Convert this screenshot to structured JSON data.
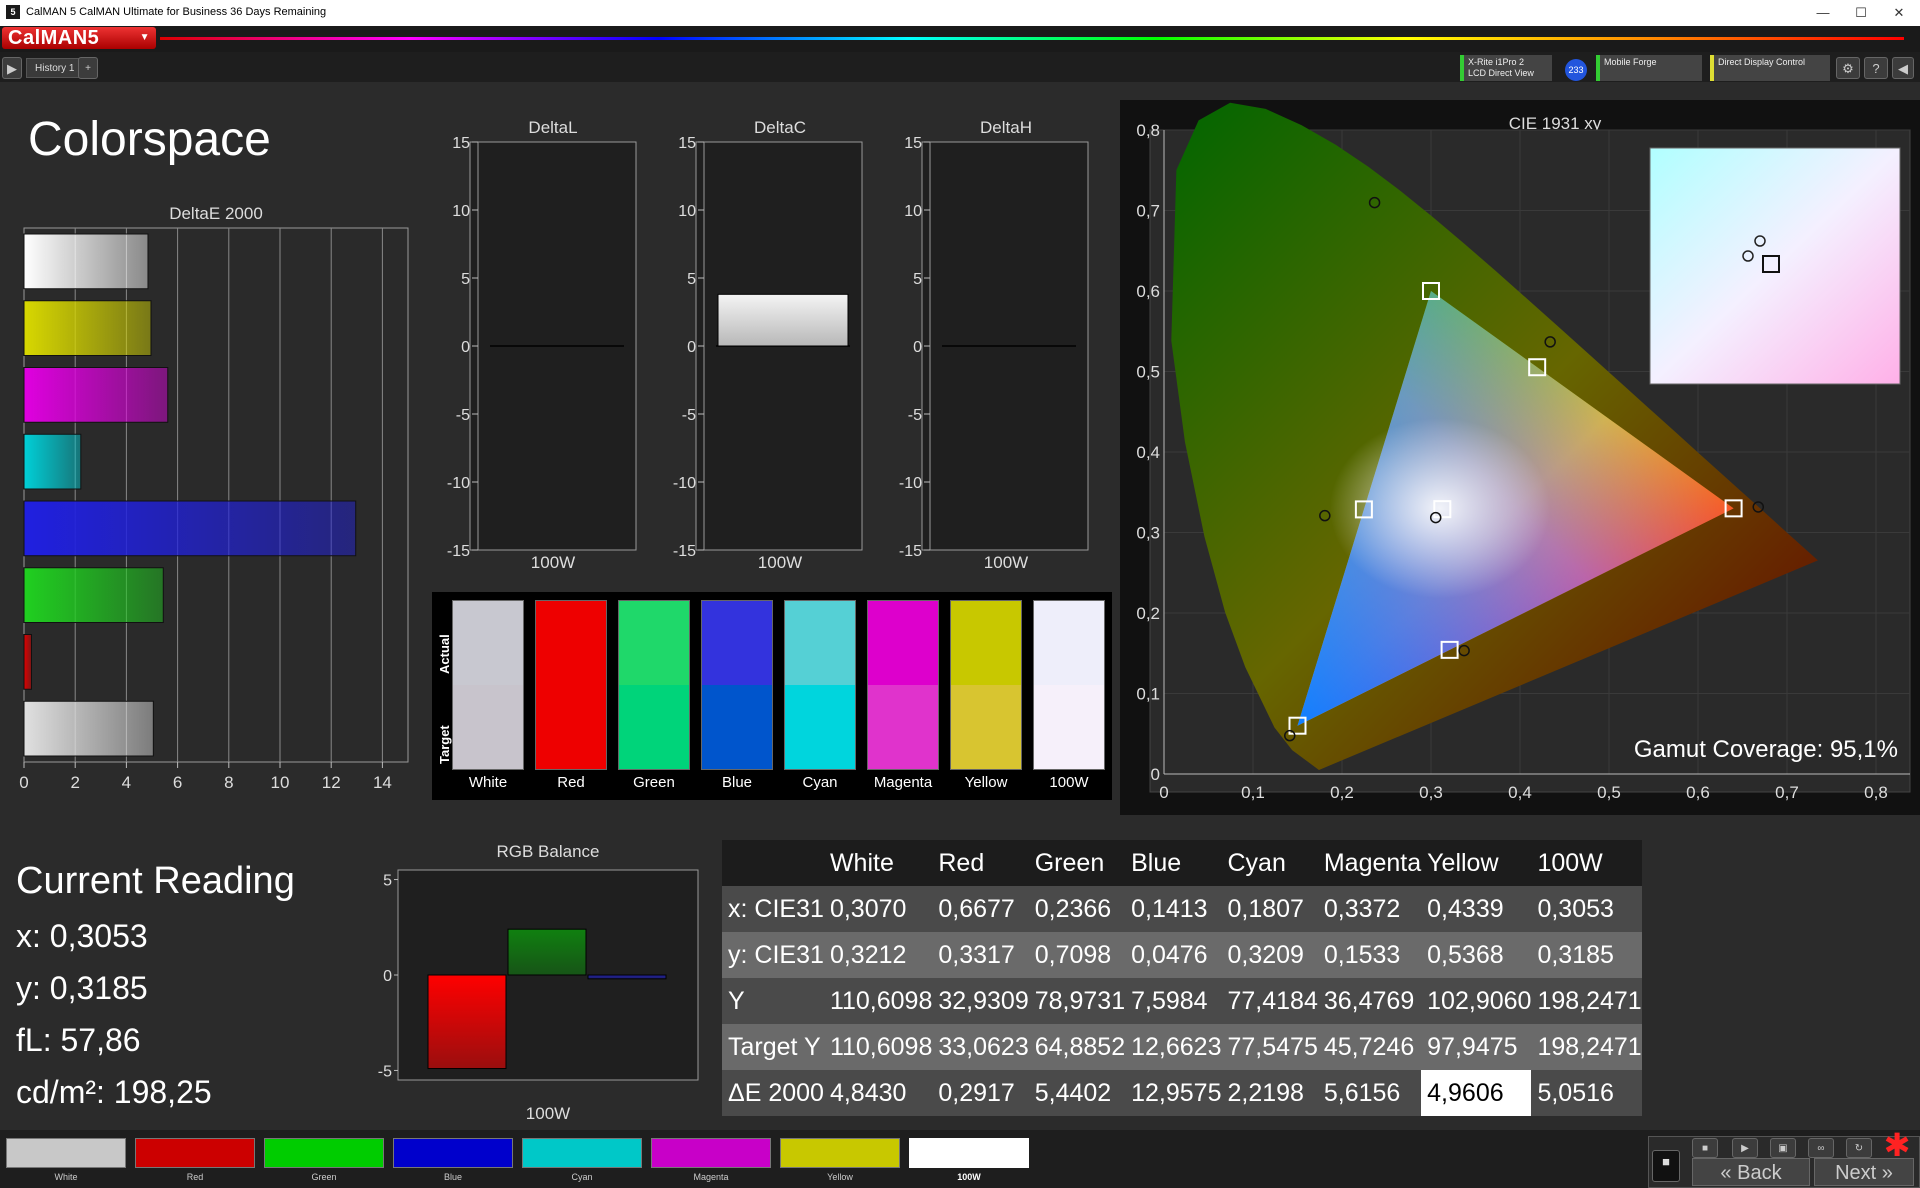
{
  "window": {
    "title": "CalMAN 5 CalMAN Ultimate for Business 36 Days Remaining",
    "app_icon": "5",
    "controls": [
      "—",
      "☐",
      "✕"
    ]
  },
  "header": {
    "logo": "CalMAN5",
    "history_tab": "History 1",
    "devices": [
      {
        "line1": "X-Rite i1Pro 2",
        "line2": "LCD Direct View",
        "color": "#33cc33"
      },
      {
        "line1": "Mobile Forge",
        "line2": "",
        "color": "#33cc33"
      },
      {
        "line1": "Direct Display Control",
        "line2": "",
        "color": "#dddd33"
      }
    ],
    "badge": "233"
  },
  "colorspace": {
    "title": "Colorspace",
    "deltae_title": "DeltaE 2000",
    "deltae_ticks": [
      "0",
      "2",
      "4",
      "6",
      "8",
      "10",
      "12",
      "14"
    ]
  },
  "deltaL": {
    "title": "DeltaL",
    "xlabel": "100W"
  },
  "deltaC": {
    "title": "DeltaC",
    "xlabel": "100W"
  },
  "deltaH": {
    "title": "DeltaH",
    "xlabel": "100W"
  },
  "delta_ticks": [
    "15",
    "10",
    "5",
    "0",
    "-5",
    "-10",
    "-15"
  ],
  "swatches": {
    "actual_label": "Actual",
    "target_label": "Target",
    "items": [
      {
        "name": "White",
        "actual": "#c8c8d0",
        "target": "#c8c4cc"
      },
      {
        "name": "Red",
        "actual": "#ee0000",
        "target": "#ee0000"
      },
      {
        "name": "Green",
        "actual": "#1fd86a",
        "target": "#00d47a"
      },
      {
        "name": "Blue",
        "actual": "#3333dd",
        "target": "#0055cc"
      },
      {
        "name": "Cyan",
        "actual": "#55d0d5",
        "target": "#00d5dd"
      },
      {
        "name": "Magenta",
        "actual": "#dd00cc",
        "target": "#e033cc"
      },
      {
        "name": "Yellow",
        "actual": "#c8c800",
        "target": "#d8c530"
      },
      {
        "name": "100W",
        "actual": "#eeeefa",
        "target": "#f6f0fa"
      }
    ]
  },
  "cie": {
    "title": "CIE 1931 xy",
    "gamut_label": "Gamut Coverage:",
    "gamut_value": "95,1%",
    "xticks": [
      "0",
      "0,1",
      "0,2",
      "0,3",
      "0,4",
      "0,5",
      "0,6",
      "0,7",
      "0,8"
    ],
    "yticks": [
      "0",
      "0,1",
      "0,2",
      "0,3",
      "0,4",
      "0,5",
      "0,6",
      "0,7",
      "0,8"
    ]
  },
  "current_reading": {
    "title": "Current Reading",
    "x": "x: 0,3053",
    "y": "y: 0,3185",
    "fl": "fL: 57,86",
    "cdm2": "cd/m²: 198,25"
  },
  "rgb_balance": {
    "title": "RGB Balance",
    "xlabel": "100W",
    "ticks": [
      "5",
      "0",
      "-5"
    ]
  },
  "table": {
    "headers": [
      "",
      "White",
      "Red",
      "Green",
      "Blue",
      "Cyan",
      "Magenta",
      "Yellow",
      "100W"
    ],
    "rows": [
      [
        "x: CIE31",
        "0,3070",
        "0,6677",
        "0,2366",
        "0,1413",
        "0,1807",
        "0,3372",
        "0,4339",
        "0,3053"
      ],
      [
        "y: CIE31",
        "0,3212",
        "0,3317",
        "0,7098",
        "0,0476",
        "0,3209",
        "0,1533",
        "0,5368",
        "0,3185"
      ],
      [
        "Y",
        "110,6098",
        "32,9309",
        "78,9731",
        "7,5984",
        "77,4184",
        "36,4769",
        "102,9060",
        "198,2471"
      ],
      [
        "Target Y",
        "110,6098",
        "33,0623",
        "64,8852",
        "12,6623",
        "77,5475",
        "45,7246",
        "97,9475",
        "198,2471"
      ],
      [
        "ΔE 2000",
        "4,8430",
        "0,2917",
        "5,4402",
        "12,9575",
        "2,2198",
        "5,6156",
        "4,9606",
        "5,0516"
      ]
    ]
  },
  "chart_data": [
    {
      "type": "bar",
      "title": "DeltaE 2000",
      "orientation": "horizontal",
      "categories": [
        "White",
        "Yellow",
        "Magenta",
        "Cyan",
        "Blue",
        "Green",
        "Red",
        "100W"
      ],
      "values": [
        4.843,
        4.9606,
        5.6156,
        2.2198,
        12.9575,
        5.4402,
        0.2917,
        5.0516
      ],
      "colors": [
        "#ffffff",
        "#d8d800",
        "#e000e0",
        "#00d0d8",
        "#2020e0",
        "#20d020",
        "#e00000",
        "#e0e0e0"
      ],
      "xlim": [
        0,
        15
      ]
    },
    {
      "type": "bar",
      "title": "DeltaL",
      "categories": [
        "100W"
      ],
      "values": [
        0
      ],
      "ylim": [
        -15,
        15
      ]
    },
    {
      "type": "bar",
      "title": "DeltaC",
      "categories": [
        "100W"
      ],
      "values": [
        3.8
      ],
      "ylim": [
        -15,
        15
      ]
    },
    {
      "type": "bar",
      "title": "DeltaH",
      "categories": [
        "100W"
      ],
      "values": [
        0
      ],
      "ylim": [
        -15,
        15
      ]
    },
    {
      "type": "bar",
      "title": "RGB Balance",
      "categories": [
        "100W"
      ],
      "series": [
        {
          "name": "R",
          "values": [
            -4.9
          ],
          "color": "#ff0000"
        },
        {
          "name": "G",
          "values": [
            2.4
          ],
          "color": "#108010"
        },
        {
          "name": "B",
          "values": [
            -0.2
          ],
          "color": "#2020a0"
        }
      ],
      "ylim": [
        -5.5,
        5.5
      ]
    },
    {
      "type": "scatter",
      "title": "CIE 1931 xy",
      "xlim": [
        0,
        0.8
      ],
      "ylim": [
        0,
        0.8
      ],
      "targets": [
        [
          0.64,
          0.33
        ],
        [
          0.3,
          0.6
        ],
        [
          0.15,
          0.06
        ],
        [
          0.3127,
          0.329
        ],
        [
          0.2246,
          0.3287
        ],
        [
          0.3209,
          0.1542
        ],
        [
          0.4193,
          0.5053
        ]
      ],
      "measured": [
        [
          0.6677,
          0.3317
        ],
        [
          0.2366,
          0.7098
        ],
        [
          0.1413,
          0.0476
        ],
        [
          0.3053,
          0.3185
        ],
        [
          0.1807,
          0.3209
        ],
        [
          0.3372,
          0.1533
        ],
        [
          0.4339,
          0.5368
        ]
      ]
    }
  ],
  "bottom_swatches": [
    {
      "label": "White",
      "color": "#c8c8c8"
    },
    {
      "label": "Red",
      "color": "#cc0000"
    },
    {
      "label": "Green",
      "color": "#00cc00"
    },
    {
      "label": "Blue",
      "color": "#0000cc"
    },
    {
      "label": "Cyan",
      "color": "#00c8c8"
    },
    {
      "label": "Magenta",
      "color": "#c800c8"
    },
    {
      "label": "Yellow",
      "color": "#c8c800"
    },
    {
      "label": "100W",
      "color": "#ffffff"
    }
  ],
  "nav": {
    "back": "Back",
    "next": "Next"
  }
}
